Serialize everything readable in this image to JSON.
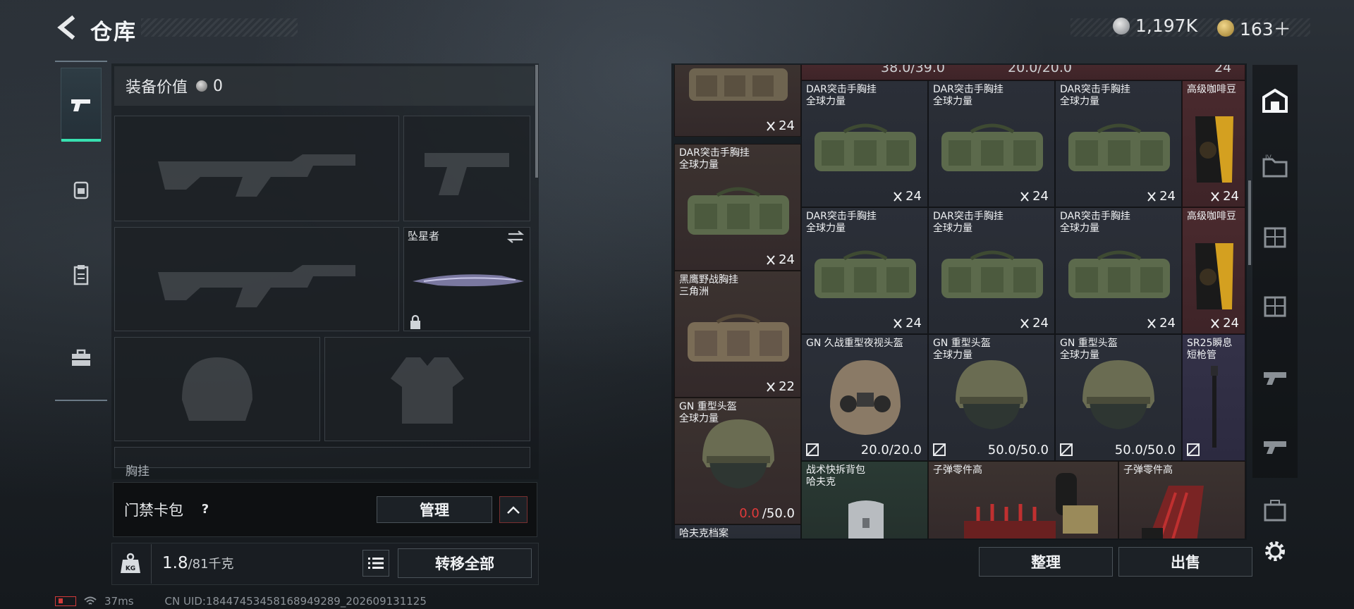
{
  "header": {
    "title": "仓库",
    "currency_silver": "1,197K",
    "currency_gold": "163＋"
  },
  "loadout": {
    "value_label": "装备价值",
    "value": "0",
    "melee_name": "坠星者",
    "chest_label": "胸挂"
  },
  "keycard": {
    "label": "门禁卡包",
    "help": "?",
    "manage_label": "管理"
  },
  "weight": {
    "current": "1.8",
    "max": "/81千克",
    "transfer_label": "转移全部"
  },
  "status": {
    "ping": "37ms",
    "uid": "CN UID:18447453458168949289_202609131125"
  },
  "storage": {
    "top_partial": [
      "38.0/39.0",
      "20.0/20.0",
      "24"
    ],
    "items": [
      {
        "id": "top-bag",
        "name1": "",
        "name2": "",
        "count": "24"
      },
      {
        "id": "dar-1",
        "name1": "DAR突击手胸挂",
        "name2": "全球力量",
        "count": "24"
      },
      {
        "id": "dar-2",
        "name1": "DAR突击手胸挂",
        "name2": "全球力量",
        "count": "24"
      },
      {
        "id": "dar-3",
        "name1": "DAR突击手胸挂",
        "name2": "全球力量",
        "count": "24"
      },
      {
        "id": "coffee-1",
        "name1": "高级咖啡豆",
        "name2": "",
        "count": "24"
      },
      {
        "id": "dar-4",
        "name1": "DAR突击手胸挂",
        "name2": "全球力量",
        "count": "24"
      },
      {
        "id": "dar-5",
        "name1": "DAR突击手胸挂",
        "name2": "全球力量",
        "count": "24"
      },
      {
        "id": "dar-6",
        "name1": "DAR突击手胸挂",
        "name2": "全球力量",
        "count": "24"
      },
      {
        "id": "dar-7",
        "name1": "DAR突击手胸挂",
        "name2": "全球力量",
        "count": "24"
      },
      {
        "id": "coffee-2",
        "name1": "高级咖啡豆",
        "name2": "",
        "count": "24"
      },
      {
        "id": "hawk",
        "name1": "黑鹰野战胸挂",
        "name2": "三角洲",
        "count": "22"
      },
      {
        "id": "gn-nv",
        "name1": "GN 久战重型夜视头盔",
        "name2": "",
        "count": "20.0/20.0"
      },
      {
        "id": "gn-h1",
        "name1": "GN 重型头盔",
        "name2": "全球力量",
        "count": "50.0/50.0"
      },
      {
        "id": "gn-h2",
        "name1": "GN 重型头盔",
        "name2": "全球力量",
        "count": "50.0/50.0"
      },
      {
        "id": "sr25",
        "name1": "SR25瞬息",
        "name2": "短枪管",
        "count": ""
      },
      {
        "id": "gn-h3",
        "name1": "GN 重型头盔",
        "name2": "全球力量",
        "count_red": "0.0",
        "count_rest": "/50.0"
      },
      {
        "id": "backpack",
        "name1": "战术快拆背包",
        "name2": "哈夫克",
        "count": ""
      },
      {
        "id": "bullet-1",
        "name1": "子弹零件高",
        "name2": "",
        "count": ""
      },
      {
        "id": "bullet-2",
        "name1": "子弹零件高",
        "name2": "",
        "count": ""
      },
      {
        "id": "bottom-left",
        "name1": "哈夫克档案",
        "name2": "",
        "count": ""
      }
    ],
    "organize_label": "整理",
    "sell_label": "出售"
  },
  "colors": {
    "accent_green": "#38e0b0",
    "durability_red": "#e03a3a"
  }
}
